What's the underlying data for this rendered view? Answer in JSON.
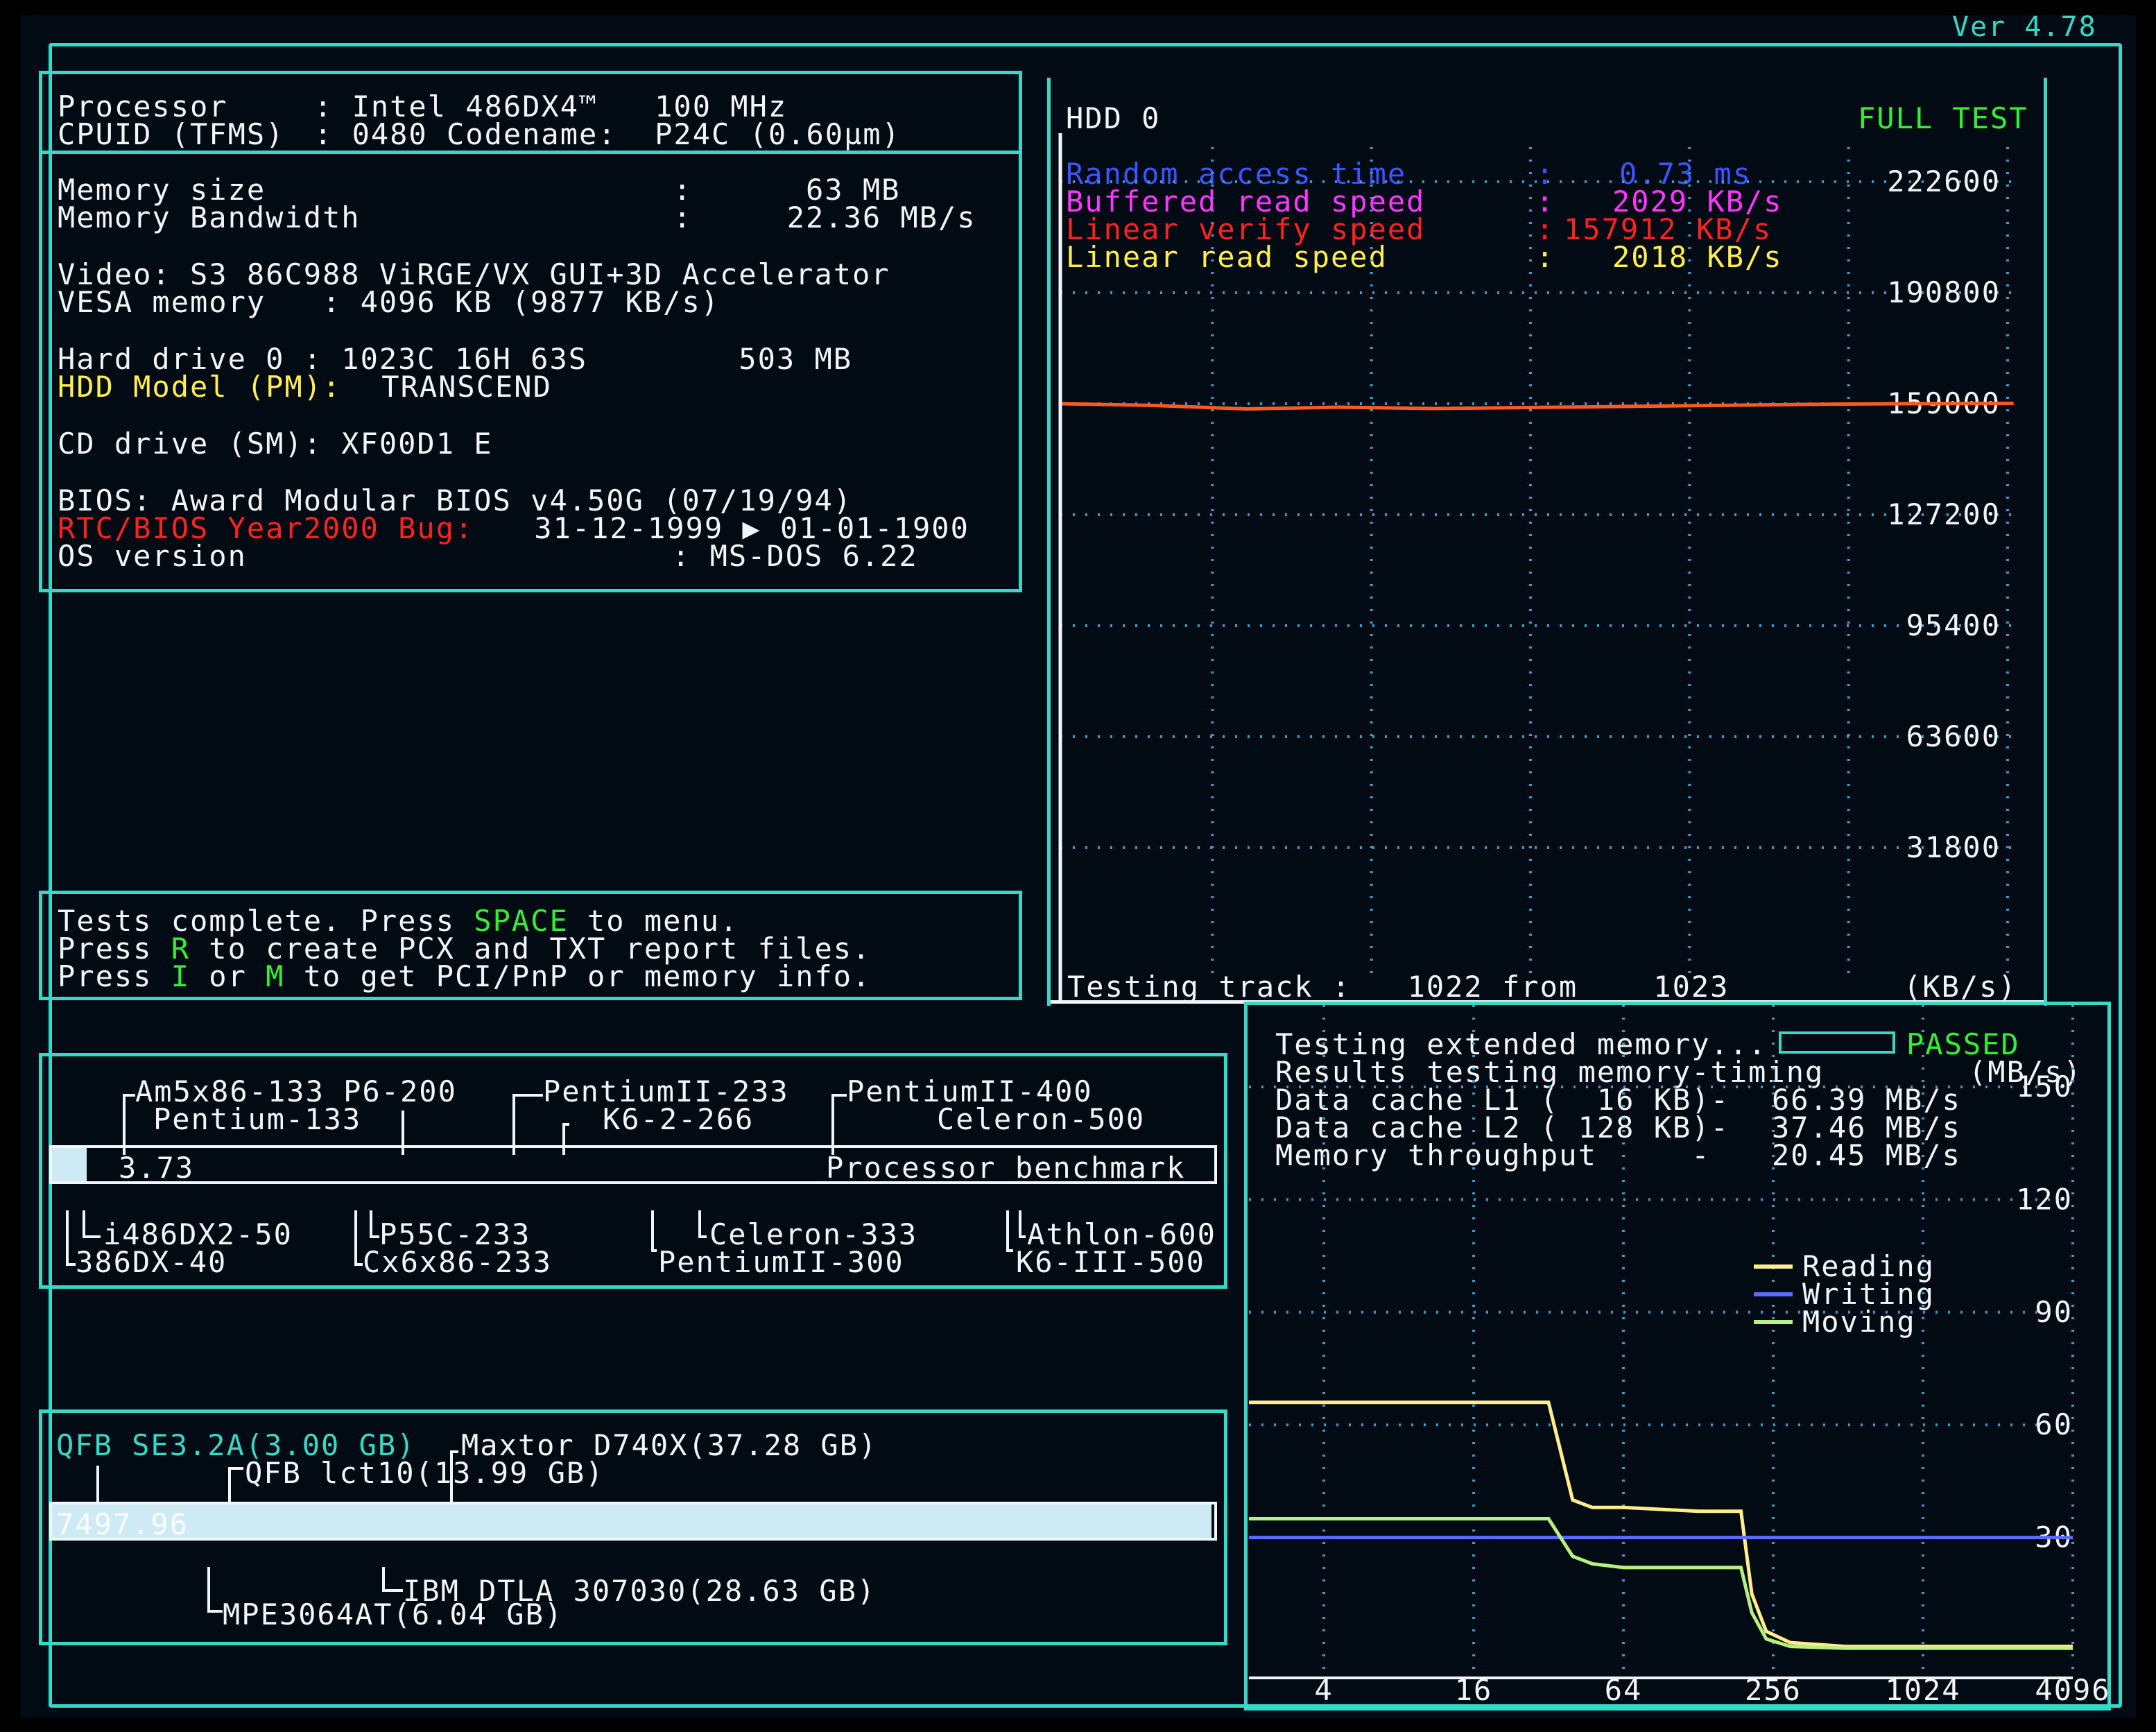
{
  "version": "Ver 4.78",
  "sysinfo": {
    "processor_label": "Processor",
    "processor_value": ": Intel 486DX4™   100 MHz",
    "cpuid_label": "CPUID (TFMS)",
    "cpuid_value": ": 0480 Codename:  P24C (0.60µm)",
    "memory_size_label": "Memory size",
    "memory_size_value": ":      63 MB",
    "memory_bw_label": "Memory Bandwidth",
    "memory_bw_value": ":     22.36 MB/s",
    "video": "Video: S3 86C988 ViRGE/VX GUI+3D Accelerator",
    "vesa": "VESA memory   : 4096 KB (9877 KB/s)",
    "hdd0": "Hard drive 0 : 1023C 16H 63S        503 MB",
    "hdd_model_label": "HDD Model (PM):",
    "hdd_model_value": " TRANSCEND",
    "cd_drive": "CD drive (SM): XF00D1 E",
    "bios": "BIOS: Award Modular BIOS v4.50G (07/19/94)",
    "rtc_label": "RTC/BIOS Year2000 Bug:",
    "rtc_value": " 31-12-1999 ▶ 01-01-1900",
    "os_label": "OS version",
    "os_value": ": MS-DOS 6.22"
  },
  "status": {
    "l1a": "Tests complete. Press ",
    "l1k": "SPACE",
    "l1b": " to menu.",
    "l2a": "Press ",
    "l2k": "R",
    "l2b": " to create PCX and TXT report files.",
    "l3a": "Press ",
    "l3k1": "I",
    "l3b": " or ",
    "l3k2": "M",
    "l3c": " to get PCI/PnP or memory info."
  },
  "cpu_bench": {
    "top_labels": [
      "Am5x86-133 P6-200",
      "Pentium-133",
      "PentiumII-233",
      "K6-2-266",
      "PentiumII-400",
      "Celeron-500"
    ],
    "bottom_labels": [
      "i486DX2-50",
      "386DX-40",
      "P55C-233",
      "Cx6x86-233",
      "Celeron-333",
      "PentiumII-300",
      "Athlon-600",
      "K6-III-500"
    ],
    "score": "3.73",
    "score_fraction": 0.03,
    "title": "Processor benchmark"
  },
  "hdd_bench": {
    "top_labels": [
      "QFB SE3.2A(3.00 GB)",
      "Maxtor D740X(37.28 GB)",
      "QFB lct10(13.99 GB)"
    ],
    "bottom_labels": [
      "IBM DTLA 307030(28.63 GB)",
      "MPE3064AT(6.04 GB)"
    ],
    "score": "7497.96",
    "score_fraction": 1.0
  },
  "hdd_panel": {
    "title": "HDD 0",
    "mode": "FULL TEST",
    "stats": [
      {
        "label": "Random access time",
        "value": "0.73",
        "unit": "ms",
        "color": "#3a55ff"
      },
      {
        "label": "Buffered read speed",
        "value": "2029",
        "unit": "KB/s",
        "color": "#ff35ff"
      },
      {
        "label": "Linear verify speed",
        "value": "157912",
        "unit": "KB/s",
        "color": "#ff2020"
      },
      {
        "label": "Linear read speed",
        "value": "2018",
        "unit": "KB/s",
        "color": "#ffee4a"
      }
    ],
    "footer_a": "Testing track :",
    "footer_b": "  1022 from    1023",
    "unit": "(KB/s)"
  },
  "mem_panel": {
    "status_label": "Testing extended memory...",
    "status_result": "PASSED",
    "results_label": "Results testing memory-timing",
    "unit": "(MB/s)",
    "rows": [
      {
        "label": "Data cache L1 (  16 KB)-",
        "value": "66.39 MB/s"
      },
      {
        "label": "Data cache L2 ( 128 KB)-",
        "value": "37.46 MB/s"
      },
      {
        "label": "Memory throughput     -",
        "value": "20.45 MB/s"
      }
    ],
    "legend": [
      "Reading",
      "Writing",
      "Moving"
    ]
  },
  "chart_data": [
    {
      "type": "line",
      "title": "",
      "ylabel": "(KB/s)",
      "ylim": [
        0,
        222600
      ],
      "yticks": [
        31800,
        63600,
        95400,
        127200,
        159000,
        190800,
        222600
      ],
      "xlim": [
        0,
        1023
      ],
      "grid": true,
      "series": [
        {
          "name": "Linear verify speed",
          "color": "#ff5a1e",
          "x": [
            0,
            100,
            200,
            300,
            400,
            500,
            600,
            700,
            800,
            900,
            1022
          ],
          "y": [
            159000,
            158500,
            157500,
            158000,
            157600,
            157900,
            158200,
            158500,
            158800,
            159000,
            159100
          ]
        }
      ]
    },
    {
      "type": "line",
      "title": "",
      "ylabel": "(MB/s)",
      "ylim": [
        0,
        150
      ],
      "yticks": [
        30,
        60,
        90,
        120,
        150
      ],
      "xticks": [
        "4",
        "16",
        "64",
        "256",
        "1024",
        "4096"
      ],
      "xscale": "log2",
      "xlim_kb": [
        2,
        4096
      ],
      "grid": true,
      "series": [
        {
          "name": "Reading",
          "color": "#ffee8a",
          "x": [
            2,
            32,
            40,
            48,
            64,
            128,
            190,
            210,
            240,
            300,
            500,
            4096
          ],
          "y": [
            66,
            66,
            40,
            38,
            38,
            37,
            37,
            15,
            5,
            2,
            1,
            1
          ]
        },
        {
          "name": "Writing",
          "color": "#5a6cff",
          "x": [
            2,
            4096
          ],
          "y": [
            30,
            30
          ]
        },
        {
          "name": "Moving",
          "color": "#b8f080",
          "x": [
            2,
            32,
            40,
            48,
            64,
            128,
            190,
            210,
            240,
            300,
            500,
            4096
          ],
          "y": [
            35,
            35,
            25,
            23,
            22,
            22,
            22,
            10,
            3,
            1,
            0.5,
            0.5
          ]
        }
      ]
    }
  ]
}
